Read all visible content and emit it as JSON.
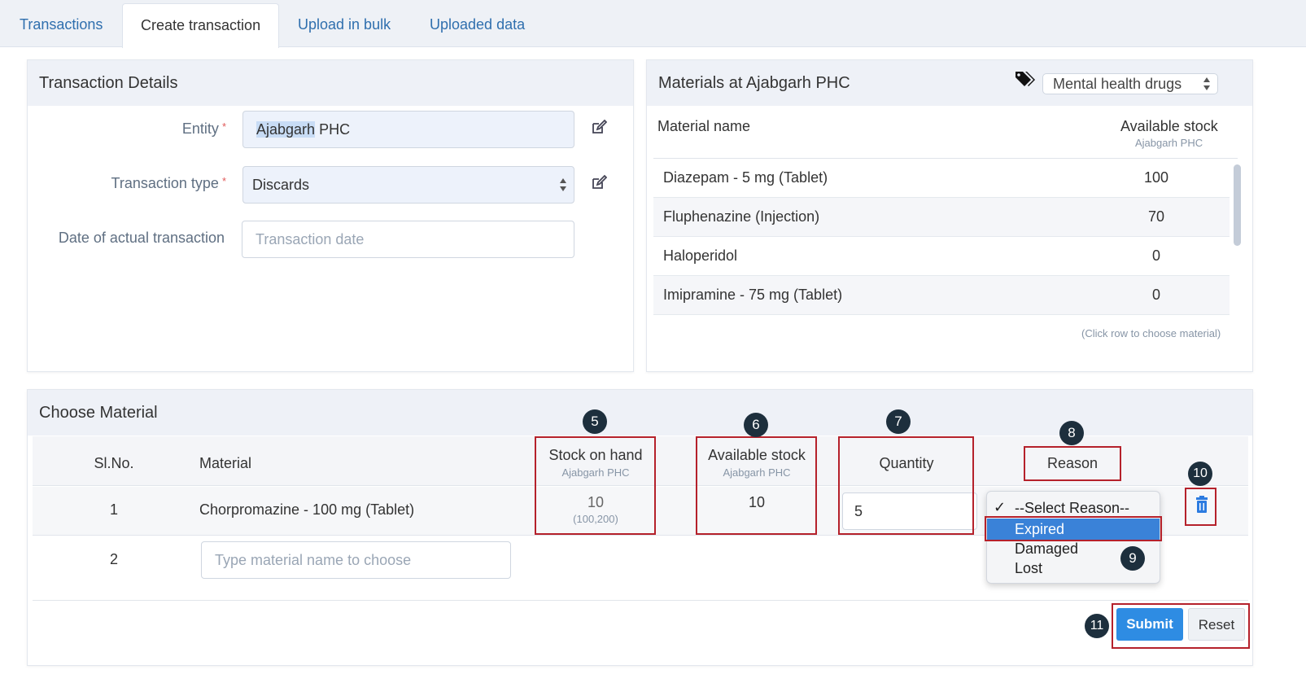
{
  "tabs": [
    {
      "label": "Transactions"
    },
    {
      "label": "Create transaction"
    },
    {
      "label": "Upload in bulk"
    },
    {
      "label": "Uploaded data"
    }
  ],
  "active_tab": "Create transaction",
  "transaction_details": {
    "title": "Transaction Details",
    "entity_label": "Entity",
    "entity_value_highlight": "Ajabgarh",
    "entity_value_rest": " PHC",
    "type_label": "Transaction type",
    "type_value": "Discards",
    "date_label": "Date of actual transaction",
    "date_placeholder": "Transaction date",
    "required_mark": "*"
  },
  "materials": {
    "title": "Materials at Ajabgarh PHC",
    "category": "Mental health drugs",
    "col_name": "Material name",
    "col_stock": "Available stock",
    "col_stock_sub": "Ajabgarh PHC",
    "rows": [
      {
        "name": "Diazepam - 5 mg (Tablet)",
        "stock": "100"
      },
      {
        "name": "Fluphenazine (Injection)",
        "stock": "70"
      },
      {
        "name": "Haloperidol",
        "stock": "0"
      },
      {
        "name": "Imipramine - 75 mg (Tablet)",
        "stock": "0"
      }
    ],
    "hint": "(Click row to choose material)"
  },
  "choose_material": {
    "title": "Choose Material",
    "col_slno": "Sl.No.",
    "col_material": "Material",
    "col_stock_on_hand": "Stock on hand",
    "col_stock_on_hand_sub": "Ajabgarh PHC",
    "col_available": "Available stock",
    "col_available_sub": "Ajabgarh PHC",
    "col_quantity": "Quantity",
    "col_reason": "Reason",
    "row1": {
      "slno": "1",
      "material": "Chorpromazine - 100 mg (Tablet)",
      "stock_on_hand": "10",
      "stock_range": "(100,200)",
      "available": "10",
      "quantity": "5"
    },
    "row2": {
      "slno": "2",
      "material_placeholder": "Type material name to choose"
    },
    "reason_options": {
      "check": "✓",
      "placeholder": "--Select Reason--",
      "selected": "Expired",
      "others": [
        "Damaged",
        "Lost"
      ]
    },
    "submit_label": "Submit",
    "reset_label": "Reset"
  },
  "badges": [
    "5",
    "6",
    "7",
    "8",
    "9",
    "10",
    "11"
  ],
  "colors": {
    "accent": "#2e8ce3",
    "annotation_box": "#b5212b",
    "badge": "#1d2f3d",
    "selected_option": "#3a82d8"
  }
}
